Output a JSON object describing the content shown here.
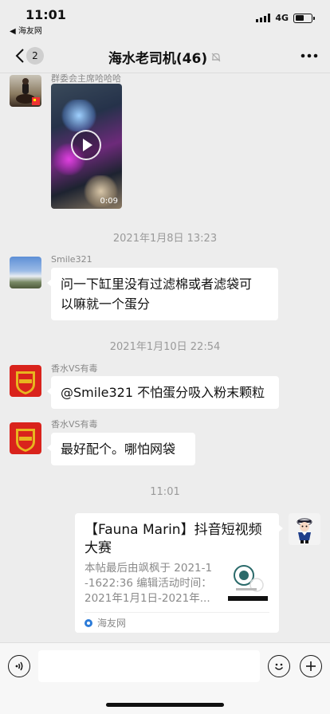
{
  "status_bar": {
    "time": "11:01",
    "back_app": "◀ 海友网",
    "network": "4G",
    "battery_level": 0.55
  },
  "nav": {
    "back_count": "2",
    "title": "海水老司机(46)"
  },
  "messages": [
    {
      "type": "video",
      "sender": "群委会主席哈哈哈",
      "duration": "0:09"
    },
    {
      "type": "time",
      "text": "2021年1月8日 13:23"
    },
    {
      "type": "text",
      "sender": "Smile321",
      "lines": [
        "问一下缸里没有过滤棉或者滤袋可",
        "以嘛就一个蛋分"
      ]
    },
    {
      "type": "time",
      "text": "2021年1月10日 22:54"
    },
    {
      "type": "text",
      "sender": "香水VS有毒",
      "lines": [
        "@Smile321 不怕蛋分吸入粉末颗粒"
      ]
    },
    {
      "type": "text",
      "sender": "香水VS有毒",
      "lines": [
        "最好配个。哪怕网袋"
      ]
    },
    {
      "type": "time",
      "text": "11:01"
    },
    {
      "type": "link",
      "title_lines": [
        "【Fauna Marin】抖音短视频",
        "大赛"
      ],
      "desc_lines": [
        "本帖最后由飒枫于 2021-1",
        "-1622:36 编辑活动时间：",
        "2021年1月1日-2021年..."
      ],
      "source": "海友网"
    }
  ],
  "colors": {
    "background": "#ededed",
    "bubble": "#ffffff",
    "badge_red": "#d9231c",
    "badge_gold": "#e8b51f"
  },
  "icons": {
    "back": "chevron-left-icon",
    "mute": "bell-off-icon",
    "more": "more-dots-icon",
    "voice": "voice-icon",
    "emoji": "emoji-icon",
    "plus": "plus-icon"
  }
}
